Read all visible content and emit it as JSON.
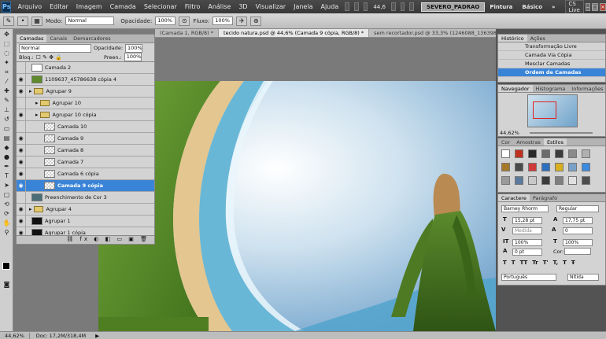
{
  "menu": {
    "app_icon": "Ps",
    "items": [
      "Arquivo",
      "Editar",
      "Imagem",
      "Camada",
      "Selecionar",
      "Filtro",
      "Análise",
      "3D",
      "Visualizar",
      "Janela",
      "Ajuda"
    ],
    "zoom": "44,6",
    "workspace_badge": "SEVERO_PADRAO",
    "workspaces": [
      "Pintura",
      "Básico"
    ],
    "more": "»",
    "cs_live": "CS Live",
    "window_controls": [
      "–",
      "□",
      "×"
    ]
  },
  "options": {
    "mode_label": "Modo:",
    "mode_value": "Normal",
    "opacity_label": "Opacidade:",
    "opacity_value": "100%",
    "flow_label": "Fluxo:",
    "flow_value": "100%"
  },
  "tabs": [
    {
      "label": "(Camada 1, RGB/8) *",
      "active": false
    },
    {
      "label": "tecido natura.psd @ 44,6% (Camada 9 cópia, RGB/8) *",
      "active": true
    },
    {
      "label": "sem recortador.psd @ 33,3% (1246088_13639858 cópia, RGB/8)",
      "active": false
    }
  ],
  "layers": {
    "tabs": [
      "Camadas",
      "Canais",
      "Demarcadores"
    ],
    "blend_mode": "Normal",
    "opacity_label": "Opacidade:",
    "opacity_value": "100%",
    "lock_label": "Bloq.:",
    "fill_label": "Preen.:",
    "fill_value": "100%",
    "rows": [
      {
        "name": "Camada 2",
        "kind": "layer",
        "thumb": "white",
        "indent": 0,
        "eye": false,
        "selected": false
      },
      {
        "name": "1109637_45786638 cópia 4",
        "kind": "layer",
        "thumb": "grass",
        "indent": 0,
        "eye": true,
        "selected": false
      },
      {
        "name": "Agrupar 9",
        "kind": "group",
        "indent": 0,
        "eye": true,
        "selected": false
      },
      {
        "name": "Agrupar 10",
        "kind": "group",
        "indent": 1,
        "eye": false,
        "selected": false
      },
      {
        "name": "Agrupar 10 cópia",
        "kind": "group",
        "indent": 1,
        "eye": true,
        "selected": false
      },
      {
        "name": "Camada 10",
        "kind": "layer",
        "thumb": "checker",
        "indent": 2,
        "eye": false,
        "selected": false
      },
      {
        "name": "Camada 9",
        "kind": "layer",
        "thumb": "checker",
        "indent": 2,
        "eye": true,
        "selected": false
      },
      {
        "name": "Camada 8",
        "kind": "layer",
        "thumb": "checker",
        "indent": 2,
        "eye": true,
        "selected": false
      },
      {
        "name": "Camada 7",
        "kind": "layer",
        "thumb": "checker",
        "indent": 2,
        "eye": true,
        "selected": false
      },
      {
        "name": "Camada 6 cópia",
        "kind": "layer",
        "thumb": "checker",
        "indent": 2,
        "eye": true,
        "selected": false
      },
      {
        "name": "Camada 9 cópia",
        "kind": "layer",
        "thumb": "checker",
        "indent": 2,
        "eye": true,
        "selected": true
      },
      {
        "name": "Preenchimento de Cor 3",
        "kind": "layer",
        "thumb": "teal",
        "indent": 0,
        "eye": false,
        "selected": false
      },
      {
        "name": "Agrupar 4",
        "kind": "group",
        "indent": 0,
        "eye": true,
        "selected": false
      },
      {
        "name": "Agrupar 1",
        "kind": "layer",
        "thumb": "black",
        "indent": 0,
        "eye": true,
        "selected": false
      },
      {
        "name": "Agrupar 1 cópia",
        "kind": "layer",
        "thumb": "black",
        "indent": 0,
        "eye": true,
        "selected": false
      }
    ]
  },
  "history": {
    "tabs": [
      "Histórico",
      "Ações"
    ],
    "items": [
      {
        "label": "Transformação Livre",
        "selected": false
      },
      {
        "label": "Camada Via Cópia",
        "selected": false
      },
      {
        "label": "Mesclar Camadas",
        "selected": false
      },
      {
        "label": "Ordem de Camadas",
        "selected": true
      }
    ]
  },
  "navigator": {
    "tabs": [
      "Navegador",
      "Histograma",
      "Informações"
    ],
    "zoom": "44,62%"
  },
  "styles": {
    "tabs": [
      "Cor",
      "Amostras",
      "Estilos"
    ]
  },
  "character": {
    "tabs": [
      "Caractere",
      "Parágrafo"
    ],
    "font_family": "Barney Rhorm",
    "font_style": "Regular",
    "font_size": "15,28 pt",
    "leading": "17,75 pt",
    "kerning": "Medida",
    "tracking": "0",
    "vscale": "100%",
    "hscale": "100%",
    "baseline": "0 pt",
    "color_label": "Cor:",
    "style_buttons": [
      "T",
      "T",
      "TT",
      "Tr",
      "T'",
      "T,",
      "T",
      "Ŧ"
    ],
    "language": "Português",
    "antialias": "Nítida"
  },
  "status": {
    "zoom": "44,62%",
    "doc": "Doc: 17,2M/318,4M"
  }
}
